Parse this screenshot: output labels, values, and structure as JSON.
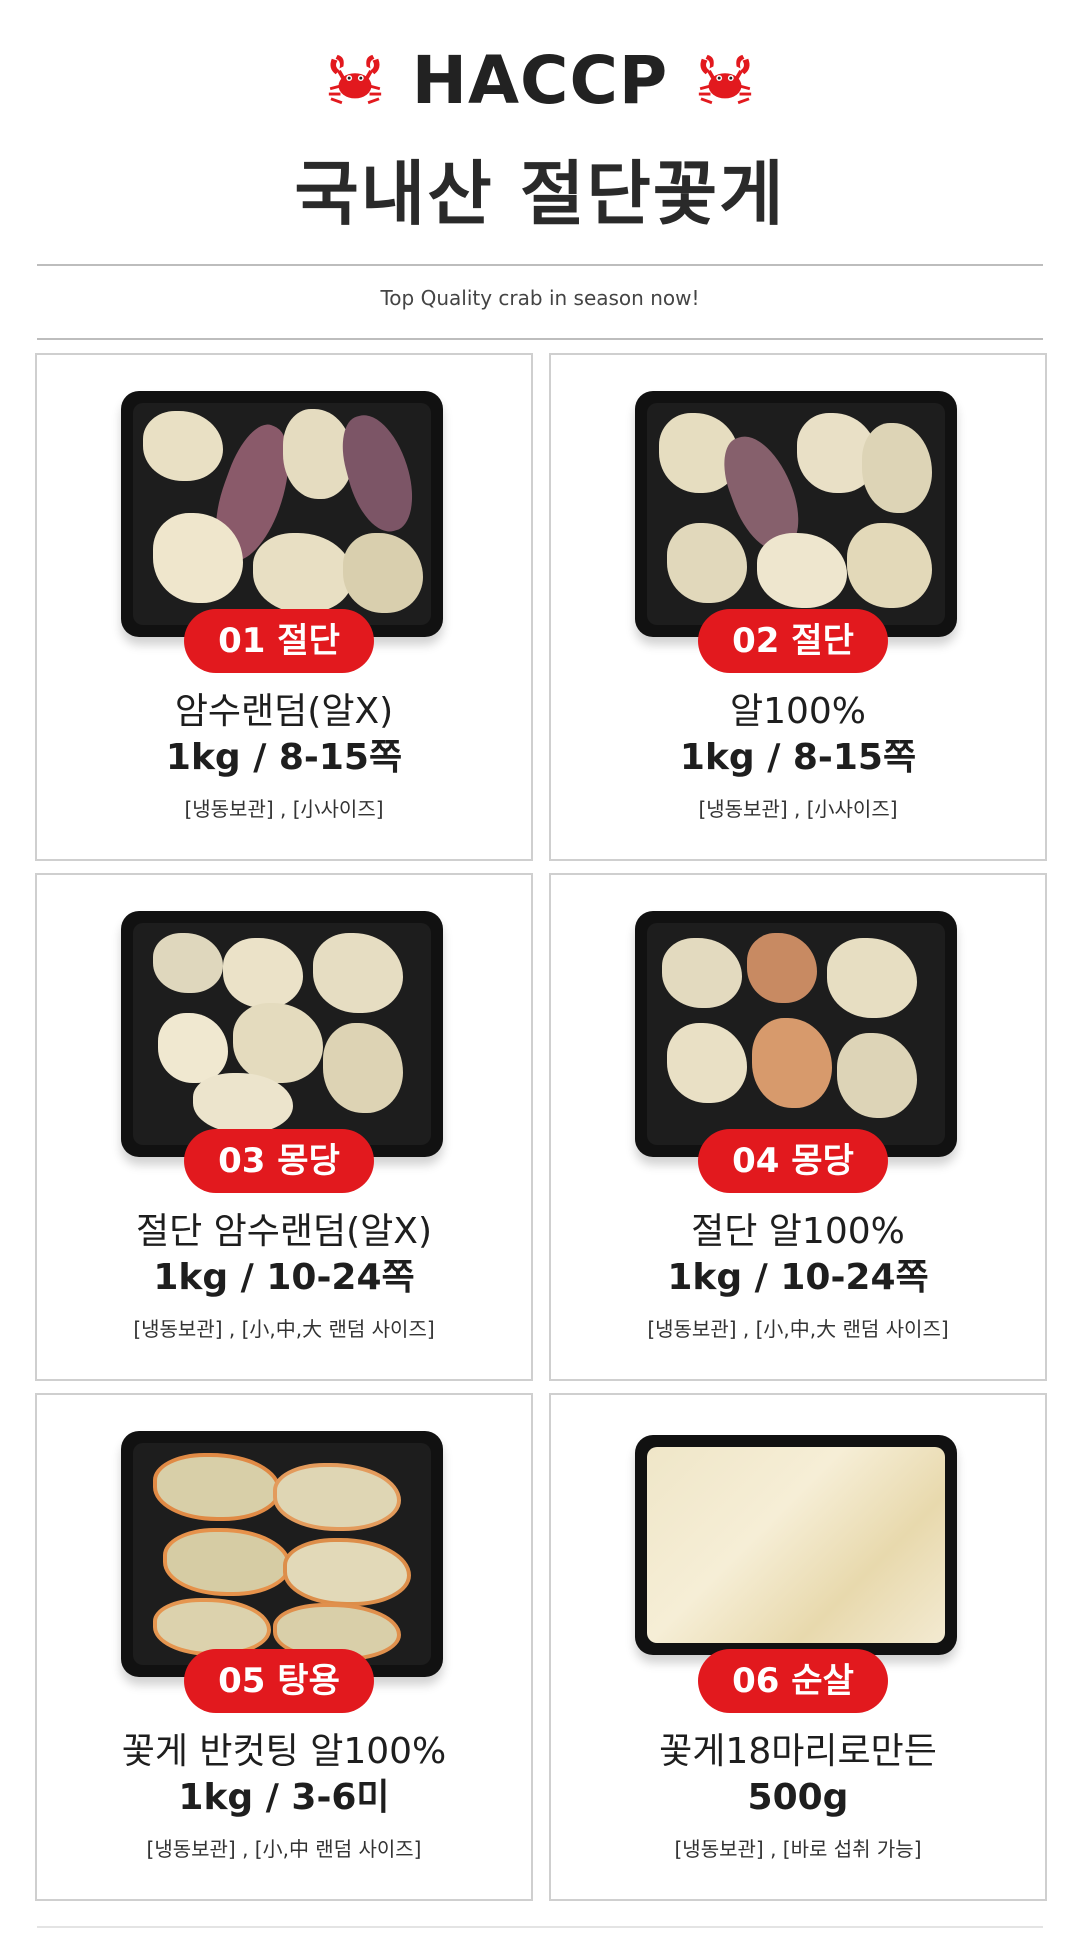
{
  "header": {
    "badge_text": "HACCP",
    "title": "국내산 절단꽃게",
    "tagline": "Top Quality crab in season now!",
    "icon": "crab-icon"
  },
  "colors": {
    "accent": "#e2191e",
    "tray": "#111111",
    "border": "#cfcfcf"
  },
  "products": [
    {
      "badge": "01 절단",
      "name": "암수랜덤(알X)",
      "weight": "1kg / 8-15쪽",
      "note": "[냉동보관] , [小사이즈]"
    },
    {
      "badge": "02 절단",
      "name": "알100%",
      "weight": "1kg / 8-15쪽",
      "note": "[냉동보관] , [小사이즈]"
    },
    {
      "badge": "03 몽당",
      "name": "절단 암수랜덤(알X)",
      "weight": "1kg / 10-24쪽",
      "note": "[냉동보관] , [小,中,大 랜덤 사이즈]"
    },
    {
      "badge": "04 몽당",
      "name": "절단 알100%",
      "weight": "1kg / 10-24쪽",
      "note": "[냉동보관] , [小,中,大 랜덤 사이즈]"
    },
    {
      "badge": "05 탕용",
      "name": "꽃게 반컷팅 알100%",
      "weight": "1kg / 3-6미",
      "note": "[냉동보관] , [小,中 랜덤 사이즈]"
    },
    {
      "badge": "06 순살",
      "name": "꽃게18마리로만든",
      "weight": "500g",
      "note": "[냉동보관] , [바로 섭취 가능]"
    }
  ]
}
